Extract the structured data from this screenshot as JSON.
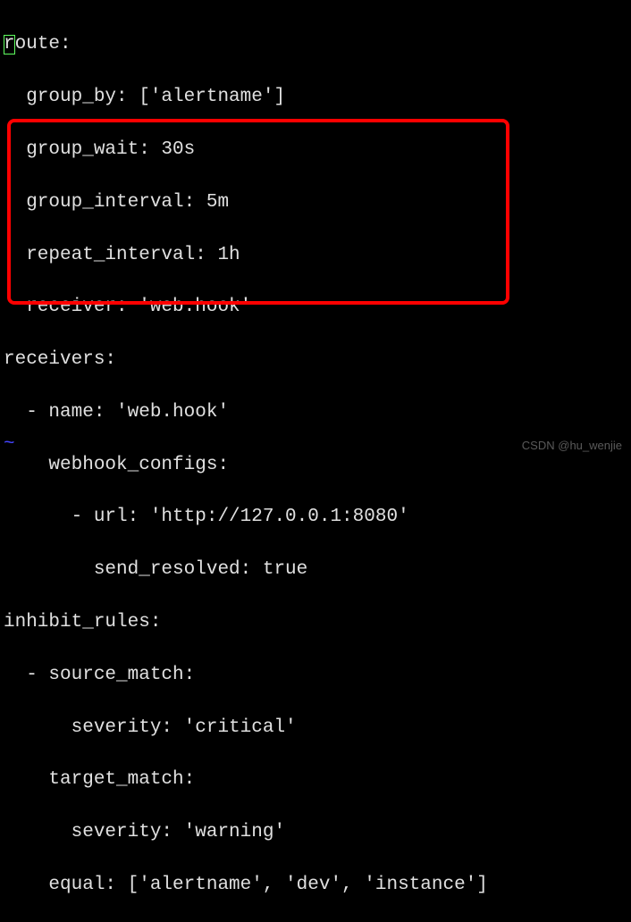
{
  "code": {
    "l1_first_char": "r",
    "l1_rest": "oute:",
    "l2": "  group_by: ['alertname']",
    "l3": "  group_wait: 30s",
    "l4": "  group_interval: 5m",
    "l5": "  repeat_interval: 1h",
    "l6": "  receiver: 'web.hook'",
    "l7": "receivers:",
    "l8": "  - name: 'web.hook'",
    "l9": "    webhook_configs:",
    "l10": "      - url: 'http://127.0.0.1:8080'",
    "l11": "        send_resolved: true",
    "l12": "inhibit_rules:",
    "l13": "  - source_match:",
    "l14": "      severity: 'critical'",
    "l15": "    target_match:",
    "l16": "      severity: 'warning'",
    "l17": "    equal: ['alertname', 'dev', 'instance']"
  },
  "tilde": "~",
  "watermark": "CSDN @hu_wenjie"
}
